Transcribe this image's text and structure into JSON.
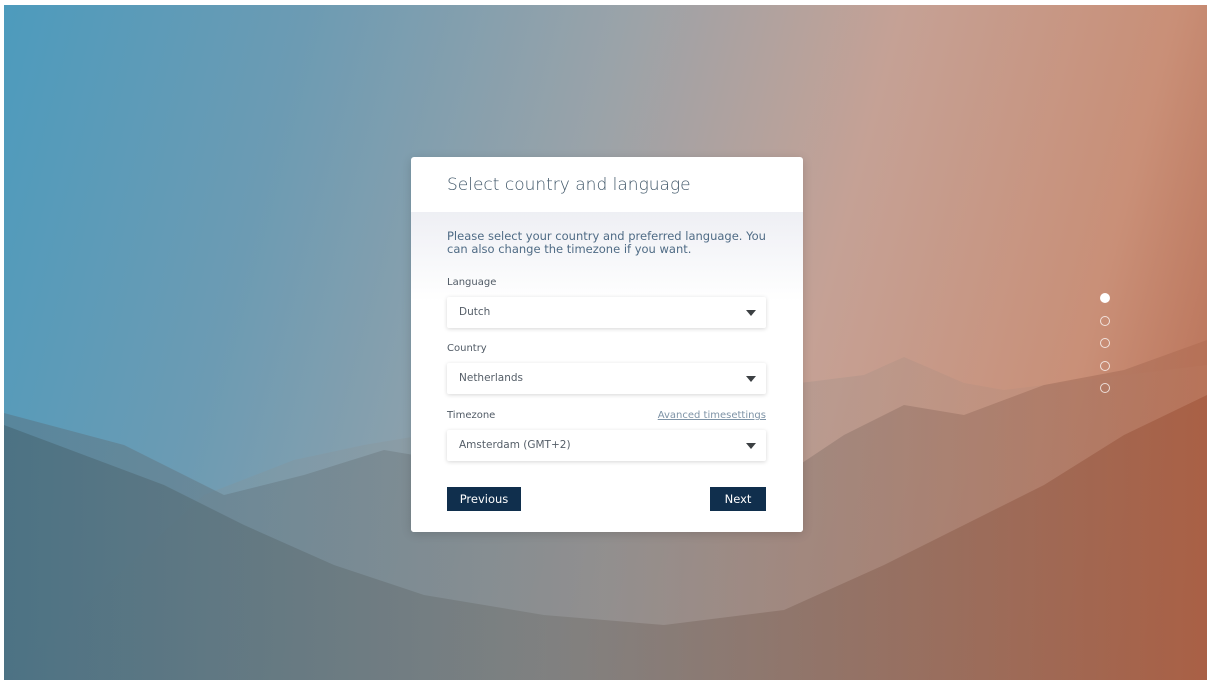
{
  "dialog": {
    "title": "Select country and language",
    "intro": "Please select your country and preferred language. You can also change the timezone if you want."
  },
  "fields": {
    "language": {
      "label": "Language",
      "value": "Dutch"
    },
    "country": {
      "label": "Country",
      "value": "Netherlands"
    },
    "timezone": {
      "label": "Timezone",
      "value": "Amsterdam (GMT+2)",
      "advanced_link": "Avanced timesettings"
    }
  },
  "buttons": {
    "previous": "Previous",
    "next": "Next"
  },
  "steps": {
    "total": 5,
    "current": 1
  },
  "colors": {
    "button": "#102f4d",
    "title": "#3e5567",
    "link": "#7e93a6"
  }
}
